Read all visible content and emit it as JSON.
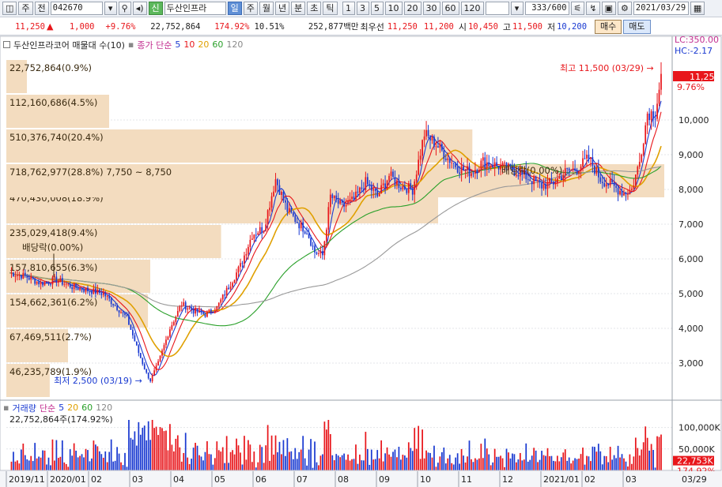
{
  "toolbar": {
    "menu_label": "주",
    "prev_label": "전",
    "code": "042670",
    "badge": "신",
    "name": "두산인프라",
    "periods": [
      "일",
      "주",
      "월",
      "년",
      "분",
      "초",
      "틱"
    ],
    "active_period": "일",
    "intervals": [
      "1",
      "3",
      "5",
      "10",
      "20",
      "30",
      "60",
      "120"
    ],
    "count": "333/600",
    "date": "2021/03/29"
  },
  "quote": {
    "price": "11,250",
    "change": "1,000",
    "change_pct": "+9.76%",
    "volume": "22,752,864",
    "vol_ratio": "174.92%",
    "turnover": "10.51%",
    "amount": "252,877백만",
    "priority_label": "최우선",
    "ask": "11,250",
    "bid": "11,200",
    "open_label": "시",
    "open": "10,450",
    "high_label": "고",
    "high": "11,500",
    "low_label": "저",
    "low": "10,200",
    "buy": "매수",
    "sell": "매도"
  },
  "legend_price": {
    "title": "두산인프라코어 매물대 수(10)",
    "ma_title": "종가 단순",
    "periods": [
      "5",
      "10",
      "20",
      "60",
      "120"
    ]
  },
  "legend_volume": {
    "title": "거래량",
    "ma_title": "단순",
    "periods": [
      "5",
      "20",
      "60",
      "120"
    ],
    "value": "22,752,864주(174.92%)"
  },
  "colors": {
    "up": "#e8161b",
    "down": "#1a3ad1",
    "ma5": "#1a3ad1",
    "ma10": "#e8161b",
    "ma20": "#e0a000",
    "ma60": "#2aa02a",
    "ma120": "#999999",
    "volume_profile": "#f3dcbf"
  },
  "chart_data": [
    {
      "type": "candlestick",
      "ylim": [
        2000,
        12000
      ],
      "yticks": [
        3000,
        4000,
        5000,
        6000,
        7000,
        8000,
        9000,
        10000
      ],
      "ytick_labels": [
        "3,000",
        "4,000",
        "5,000",
        "6,000",
        "7,000",
        "8,000",
        "9,000",
        "10,000"
      ],
      "xtick_labels": [
        "2019/11",
        "2020/01",
        "02",
        "03",
        "04",
        "05",
        "06",
        "07",
        "08",
        "09",
        "10",
        "11",
        "12",
        "2021/01",
        "02",
        "03"
      ],
      "axis_top": {
        "lc": "LC:350.00",
        "hc": "HC:-2.17",
        "last": "11,250",
        "last_pct": "9.76%"
      },
      "x_right_label": "03/29",
      "annotations": [
        {
          "text": "최고 11,500 (03/29)",
          "value": 11500
        },
        {
          "text": "최저 2,500 (03/19)",
          "value": 2500
        },
        {
          "text": "배당락(0.00%)",
          "value": 6150
        },
        {
          "text": "배당락(0.00%)",
          "value": 8550
        }
      ],
      "volume_profile": [
        {
          "label": "46,235,789(1.9%)",
          "pct": 1.9,
          "low": 2000,
          "high": 3000
        },
        {
          "label": "67,469,511(2.7%)",
          "pct": 2.7,
          "low": 3000,
          "high": 4000
        },
        {
          "label": "154,662,361(6.2%)",
          "pct": 6.2,
          "low": 4000,
          "high": 5000
        },
        {
          "label": "157,810,655(6.3%)",
          "pct": 6.3,
          "low": 5000,
          "high": 6000
        },
        {
          "label": "235,029,418(9.4%)",
          "pct": 9.4,
          "low": 6000,
          "high": 7000
        },
        {
          "label": "470,430,008(18.9%)",
          "pct": 18.9,
          "low": 7000,
          "high": 8000
        },
        {
          "label": "718,762,977(28.8%) 7,750 ~ 8,750",
          "pct": 28.8,
          "low": 7750,
          "high": 8750
        },
        {
          "label": "510,376,740(20.4%)",
          "pct": 20.4,
          "low": 8750,
          "high": 9750
        },
        {
          "label": "112,160,686(4.5%)",
          "pct": 4.5,
          "low": 9750,
          "high": 10750
        },
        {
          "label": "22,752,864(0.9%)",
          "pct": 0.9,
          "low": 10750,
          "high": 11750
        }
      ],
      "close_path": [
        [
          0,
          5600
        ],
        [
          8,
          5500
        ],
        [
          16,
          5300
        ],
        [
          24,
          5400
        ],
        [
          32,
          5200
        ],
        [
          40,
          5100
        ],
        [
          48,
          5000
        ],
        [
          55,
          4600
        ],
        [
          60,
          4300
        ],
        [
          66,
          3300
        ],
        [
          70,
          2700
        ],
        [
          72,
          2500
        ],
        [
          76,
          3000
        ],
        [
          82,
          4000
        ],
        [
          88,
          4700
        ],
        [
          94,
          4500
        ],
        [
          100,
          4400
        ],
        [
          106,
          4600
        ],
        [
          112,
          5200
        ],
        [
          118,
          5800
        ],
        [
          124,
          6700
        ],
        [
          130,
          6900
        ],
        [
          136,
          8300
        ],
        [
          142,
          7400
        ],
        [
          148,
          7000
        ],
        [
          152,
          6800
        ],
        [
          156,
          6200
        ],
        [
          160,
          6100
        ],
        [
          164,
          7800
        ],
        [
          170,
          7500
        ],
        [
          176,
          7700
        ],
        [
          182,
          8200
        ],
        [
          188,
          7800
        ],
        [
          194,
          8400
        ],
        [
          200,
          8100
        ],
        [
          206,
          8000
        ],
        [
          212,
          9600
        ],
        [
          218,
          9300
        ],
        [
          224,
          8900
        ],
        [
          230,
          8600
        ],
        [
          236,
          8500
        ],
        [
          242,
          8800
        ],
        [
          248,
          8700
        ],
        [
          254,
          8600
        ],
        [
          260,
          8500
        ],
        [
          266,
          8300
        ],
        [
          272,
          8100
        ],
        [
          278,
          8200
        ],
        [
          284,
          8500
        ],
        [
          290,
          8600
        ],
        [
          296,
          8900
        ],
        [
          302,
          8300
        ],
        [
          308,
          8100
        ],
        [
          314,
          7900
        ],
        [
          318,
          8000
        ],
        [
          322,
          8800
        ],
        [
          326,
          10200
        ],
        [
          330,
          10200
        ],
        [
          333,
          11250
        ]
      ]
    },
    {
      "type": "bar",
      "name": "거래량",
      "yticks": [
        50000,
        100000
      ],
      "ytick_labels": [
        "50,000K",
        "100,000K"
      ],
      "last_label": "22,753K",
      "last_pct": "174.92%"
    }
  ]
}
